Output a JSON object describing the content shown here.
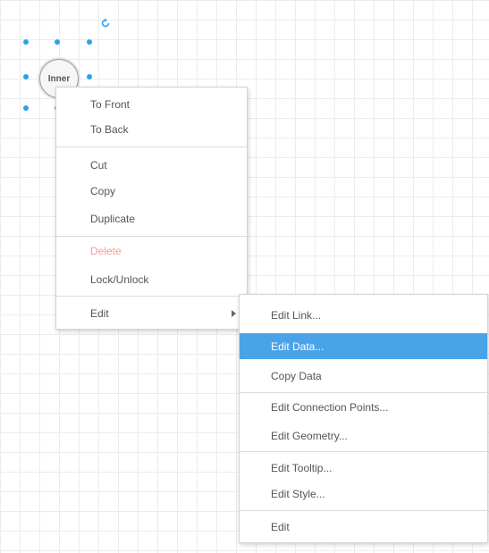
{
  "node": {
    "label": "Inner"
  },
  "context_menu": {
    "items": [
      {
        "label": "To Front"
      },
      {
        "label": "To Back"
      },
      {
        "label": "Cut"
      },
      {
        "label": "Copy"
      },
      {
        "label": "Duplicate"
      },
      {
        "label": "Delete",
        "disabled": true
      },
      {
        "label": "Lock/Unlock"
      },
      {
        "label": "Edit"
      }
    ]
  },
  "edit_submenu": {
    "items": [
      {
        "label": "Edit Link..."
      },
      {
        "label": "Edit Data...",
        "highlighted": true
      },
      {
        "label": "Copy Data"
      },
      {
        "label": "Edit Connection Points..."
      },
      {
        "label": "Edit Geometry..."
      },
      {
        "label": "Edit Tooltip..."
      },
      {
        "label": "Edit Style..."
      },
      {
        "label": "Edit"
      }
    ]
  },
  "colors": {
    "handle": "#29a3e8",
    "highlight": "#4aa3e6",
    "disabled_text": "#f0a096",
    "grid": "#e9edf0"
  }
}
